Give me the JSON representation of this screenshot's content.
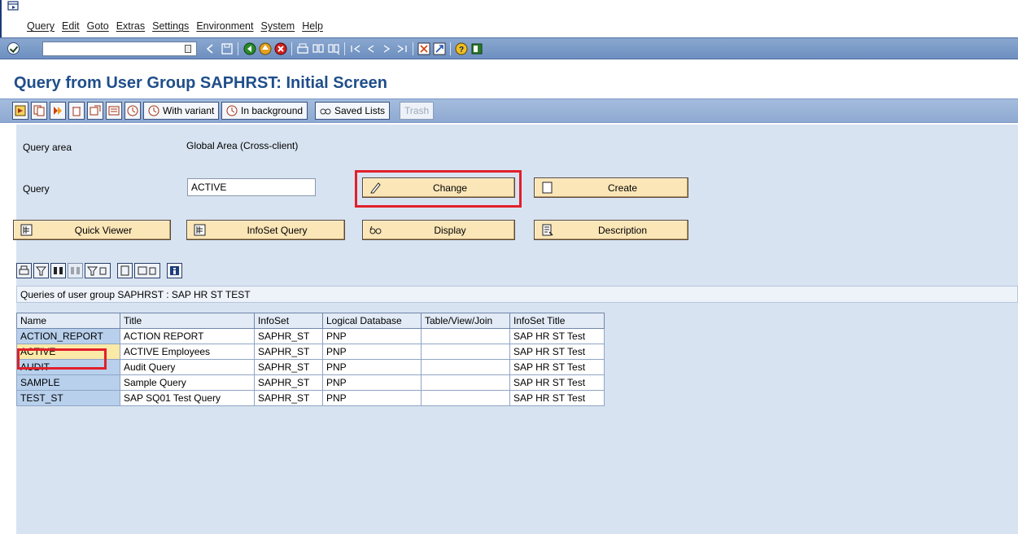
{
  "menu": {
    "items": [
      "Query",
      "Edit",
      "Goto",
      "Extras",
      "Settings",
      "Environment",
      "System",
      "Help"
    ]
  },
  "system_toolbar": {
    "command_value": "",
    "icons": [
      "enter-icon",
      "back-icon",
      "save-icon",
      "back-nav-icon",
      "exit-icon",
      "cancel-icon",
      "print-icon",
      "find-icon",
      "find-next-icon",
      "first-page-icon",
      "previous-page-icon",
      "next-page-icon",
      "last-page-icon",
      "create-session-icon",
      "shortcut-icon",
      "help-icon",
      "layout-icon"
    ]
  },
  "page": {
    "title": "Query from User Group SAPHRST: Initial Screen"
  },
  "app_toolbar": {
    "with_variant": "With variant",
    "in_background": "In background",
    "saved_lists": "Saved Lists",
    "trash": "Trash"
  },
  "form": {
    "query_area_label": "Query area",
    "query_area_value": "Global Area (Cross-client)",
    "query_label": "Query",
    "query_value": "ACTIVE",
    "change_label": "Change",
    "create_label": "Create",
    "quick_viewer_label": "Quick Viewer",
    "infoset_query_label": "InfoSet Query",
    "display_label": "Display",
    "description_label": "Description"
  },
  "grid": {
    "title": "Queries of user group SAPHRST : SAP HR ST TEST",
    "columns": [
      "Name",
      "Title",
      "InfoSet",
      "Logical Database",
      "Table/View/Join",
      "InfoSet Title"
    ],
    "rows": [
      [
        "ACTION_REPORT",
        "ACTION REPORT",
        "SAPHR_ST",
        "PNP",
        "",
        "SAP HR ST Test"
      ],
      [
        "ACTIVE",
        "ACTIVE Employees",
        "SAPHR_ST",
        "PNP",
        "",
        "SAP HR ST Test"
      ],
      [
        "AUDIT",
        "Audit Query",
        "SAPHR_ST",
        "PNP",
        "",
        "SAP HR ST Test"
      ],
      [
        "SAMPLE",
        "Sample Query",
        "SAPHR_ST",
        "PNP",
        "",
        "SAP HR ST Test"
      ],
      [
        "TEST_ST",
        "SAP  SQ01 Test Query",
        "SAPHR_ST",
        "PNP",
        "",
        "SAP HR ST Test"
      ]
    ]
  },
  "colors": {
    "highlight": "#e0202a",
    "button_bg": "#fbe6b8",
    "title_blue": "#1f4e8a",
    "main_bg": "#d8e3f1"
  }
}
